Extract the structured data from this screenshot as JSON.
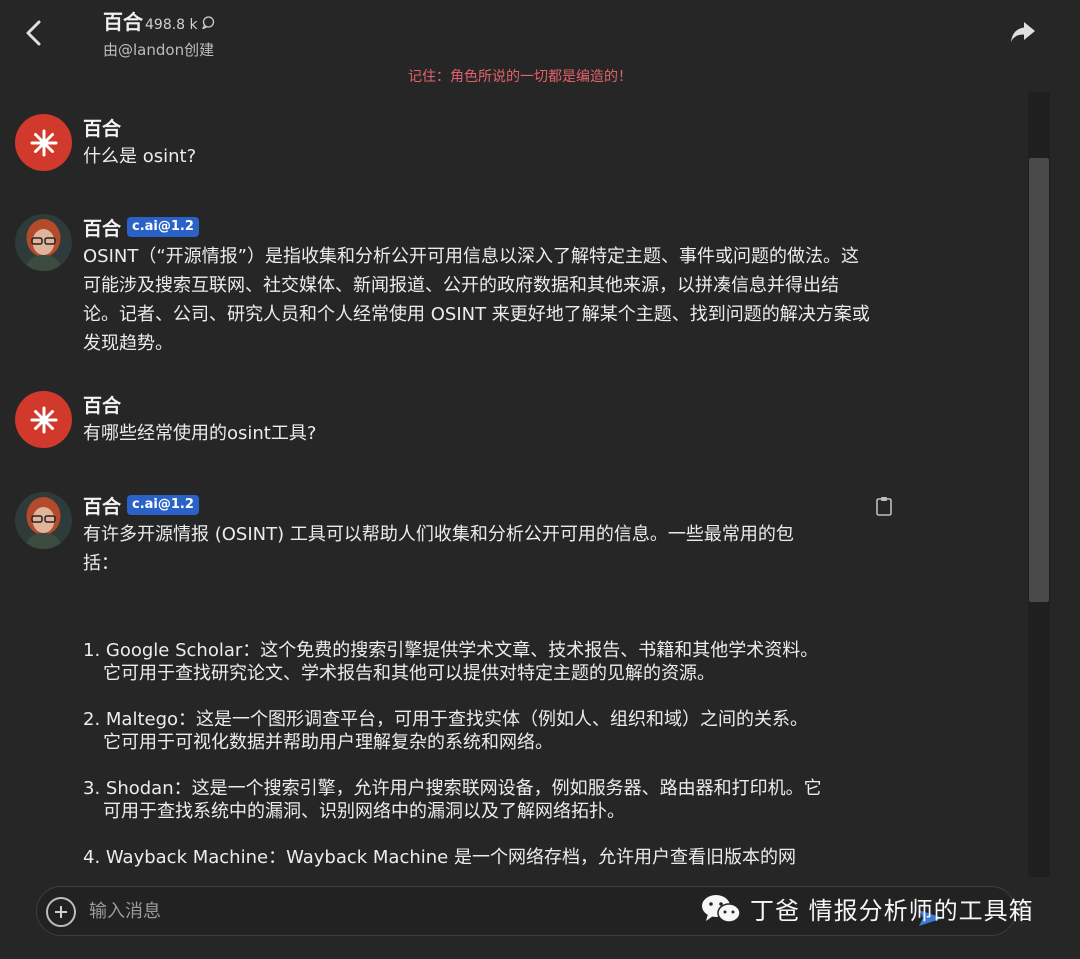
{
  "header": {
    "title": "百合",
    "count": "498.8 k",
    "creator": "由@landon创建",
    "warning": "记住：角色所说的一切都是编造的！"
  },
  "messages": [
    {
      "sender": "百合",
      "text": "什么是 osint?"
    },
    {
      "sender": "百合",
      "badge": "c.ai@1.2",
      "text": "OSINT（“开源情报”）是指收集和分析公开可用信息以深入了解特定主题、事件或问题的做法。这可能涉及搜索互联网、社交媒体、新闻报道、公开的政府数据和其他来源，以拼凑信息并得出结论。记者、公司、研究人员和个人经常使用 OSINT 来更好地了解某个主题、找到问题的解决方案或发现趋势。"
    },
    {
      "sender": "百合",
      "text": "有哪些经常使用的osint工具?"
    },
    {
      "sender": "百合",
      "badge": "c.ai@1.2",
      "text": "有许多开源情报 (OSINT) 工具可以帮助人们收集和分析公开可用的信息。一些最常用的包括：",
      "list": [
        "1. Google Scholar：这个免费的搜索引擎提供学术文章、技术报告、书籍和其他学术资料。它可用于查找研究论文、学术报告和其他可以提供对特定主题的见解的资源。",
        "2. Maltego：这是一个图形调查平台，可用于查找实体（例如人、组织和域）之间的关系。它可用于可视化数据并帮助用户理解复杂的系统和网络。",
        "3. Shodan：这是一个搜索引擎，允许用户搜索联网设备，例如服务器、路由器和打印机。它可用于查找系统中的漏洞、识别网络中的漏洞以及了解网络拓扑。",
        "4. Wayback Machine：Wayback Machine 是一个网络存档，允许用户查看旧版本的网"
      ]
    }
  ],
  "input": {
    "placeholder": "输入消息"
  },
  "watermark": {
    "text": "丁爸 情报分析师的工具箱"
  },
  "colors": {
    "background": "#262626",
    "warning": "#e2626b",
    "badge": "#2b62c8",
    "user_avatar": "#d0392b"
  }
}
